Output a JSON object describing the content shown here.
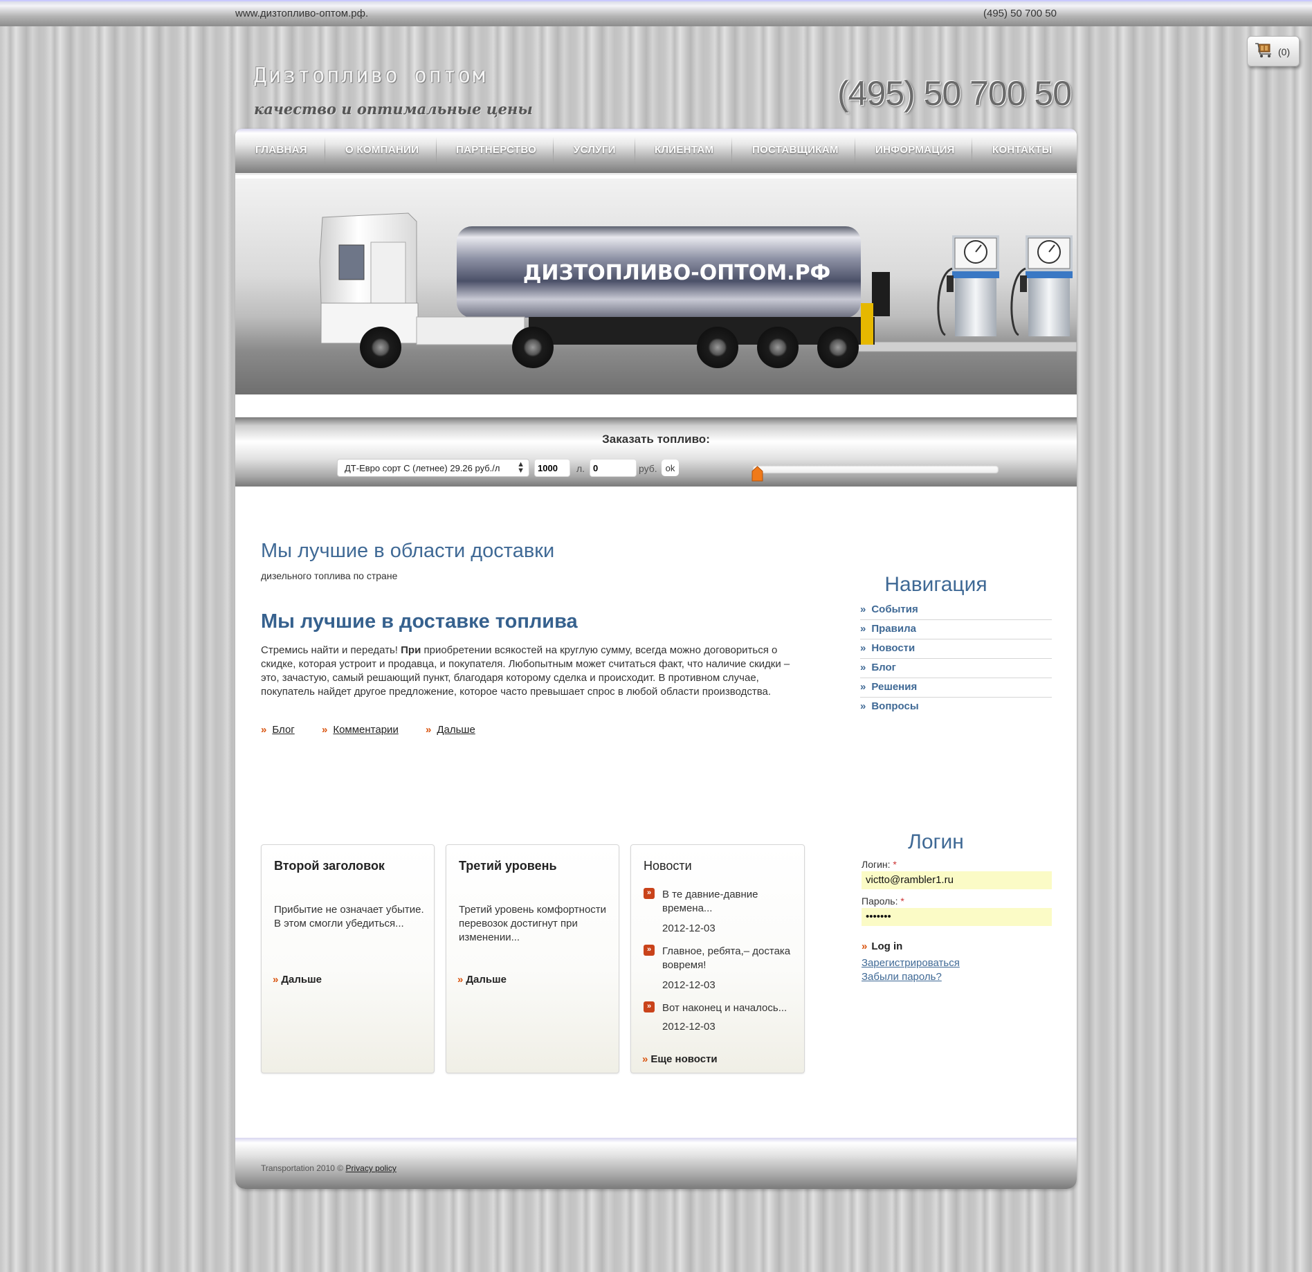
{
  "topbar": {
    "site": "www.дизтопливо-оптом.рф.",
    "phone": "(495) 50 700 50"
  },
  "cart": {
    "icon": "cart-icon",
    "count": "(0)"
  },
  "logo": {
    "title": "Дизтопливо оптом",
    "tagline": "качество и оптимальные цены"
  },
  "header": {
    "phone": "(495) 50 700 50"
  },
  "nav": {
    "items": [
      {
        "label": "ГЛАВНАЯ"
      },
      {
        "label": "О КОМПАНИИ"
      },
      {
        "label": "ПАРТНЕРСТВО"
      },
      {
        "label": "УСЛУГИ"
      },
      {
        "label": "КЛИЕНТАМ"
      },
      {
        "label": "ПОСТАВЩИКАМ"
      },
      {
        "label": "ИНФОРМАЦИЯ"
      },
      {
        "label": "КОНТАКТЫ"
      }
    ]
  },
  "banner": {
    "tank_text": "ДИЗТОПЛИВО-ОПТОМ.РФ"
  },
  "order": {
    "title": "Заказать топливо:",
    "fuel_selected": "ДТ-Евро сорт С (летнее) 29.26 руб./л",
    "litres": "1000",
    "litres_unit": "л.",
    "rub": "0",
    "rub_unit": "руб.",
    "ok": "ok",
    "slider_fraction": 0.0
  },
  "main": {
    "heading": "Мы лучшие в области доставки",
    "subheading": "дизельного топлива по стране",
    "heading2": "Мы лучшие в доставке топлива",
    "para_lead": "Стремись найти и передать!",
    "para_bold": "При",
    "para_rest": "приобретении всякостей на круглую сумму, всегда можно договориться о скидке, которая устроит и продавца, и покупателя. Любопытным может считаться факт, что наличие скидки – это, зачастую, самый решающий пункт, благодаря которому сделка и происходит. В противном случае, покупатель найдет другое предложение, которое часто превышает спрос в любой области производства.",
    "links": [
      "Блог",
      "Комментарии",
      "Дальше"
    ]
  },
  "sidebar": {
    "nav_title": "Навигация",
    "nav_items": [
      "События",
      "Правила",
      "Новости",
      "Блог",
      "Решения",
      "Вопросы"
    ]
  },
  "boxes": {
    "box1": {
      "title": "Второй заголовок",
      "text": "Прибытие не означает убытие. В этом смогли убедиться...",
      "more": "Дальше"
    },
    "box2": {
      "title": "Третий уровень",
      "text": "Третий уровень комфортности перевозок достигнут при изменении...",
      "more": "Дальше"
    },
    "news": {
      "title": "Новости",
      "items": [
        {
          "text": "В те давние-давние времена...",
          "date": "2012-12-03"
        },
        {
          "text": "Главное, ребята,– достака вовремя!",
          "date": "2012-12-03"
        },
        {
          "text": "Вот наконец и началось...",
          "date": "2012-12-03"
        }
      ],
      "more": "Еще новости"
    }
  },
  "login": {
    "title": "Логин",
    "login_label": "Логин:",
    "login_value": "victto@rambler1.ru",
    "password_label": "Пароль:",
    "password_value": "•••••••",
    "required": "*",
    "button": "Log in",
    "register": "Зарегистрироваться",
    "forgot": "Забыли пароль?"
  },
  "footer": {
    "copy": "Transportation 2010 ©",
    "privacy": "Privacy policy"
  },
  "colors": {
    "accent": "#3f6995",
    "arrow": "#d9530e",
    "autofill": "#fbfbc6"
  }
}
